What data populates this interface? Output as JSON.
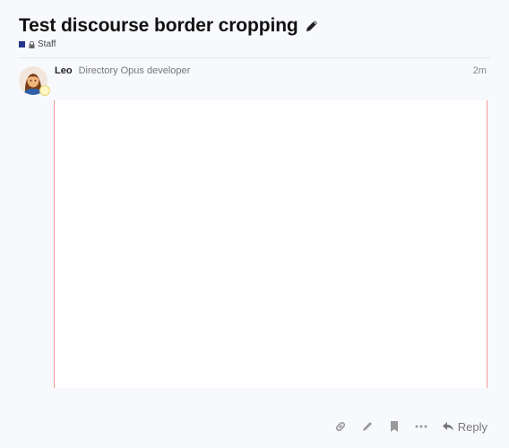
{
  "topic": {
    "title": "Test discourse border cropping",
    "edit_icon": "pencil-icon"
  },
  "category": {
    "name": "Staff",
    "color": "#25348b",
    "restricted_icon": "lock-icon"
  },
  "post": {
    "username": "Leo",
    "user_title": "Directory Opus developer",
    "time": "2m",
    "image_border_color": "#f29a9a"
  },
  "actions": {
    "icons": [
      "link-icon",
      "pencil-icon",
      "bookmark-icon",
      "ellipsis-icon"
    ],
    "reply_label": "Reply",
    "reply_icon": "reply-arrow-icon"
  }
}
